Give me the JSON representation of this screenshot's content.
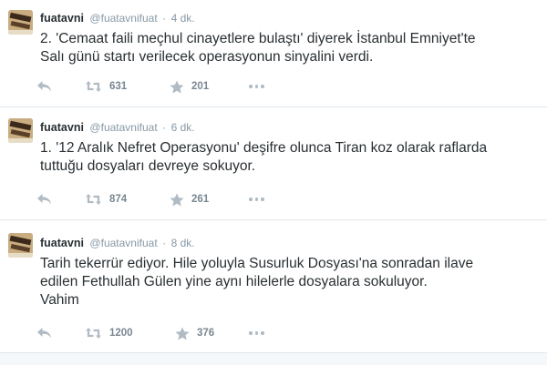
{
  "colors": {
    "text": "#292f33",
    "muted": "#8899a6",
    "action_icon": "#b1bbc3",
    "divider": "#e1e8ed",
    "background": "#ffffff"
  },
  "tweets": [
    {
      "fullname": "fuatavni",
      "username": "@fuatavnifuat",
      "separator": "·",
      "time": "4 dk.",
      "text": "2. 'Cemaat faili meçhul cinayetlere bulaştı' diyerek İstanbul Emniyet'te\nSalı günü startı verilecek operasyonun sinyalini verdi.",
      "retweets": "631",
      "favorites": "201",
      "icons": [
        "reply-icon",
        "retweet-icon",
        "favorite-icon",
        "more-icon"
      ]
    },
    {
      "fullname": "fuatavni",
      "username": "@fuatavnifuat",
      "separator": "·",
      "time": "6 dk.",
      "text": "1. '12 Aralık Nefret Operasyonu' deşifre olunca Tiran koz olarak raflarda\ntuttuğu dosyaları devreye sokuyor.",
      "retweets": "874",
      "favorites": "261",
      "icons": [
        "reply-icon",
        "retweet-icon",
        "favorite-icon",
        "more-icon"
      ]
    },
    {
      "fullname": "fuatavni",
      "username": "@fuatavnifuat",
      "separator": "·",
      "time": "8 dk.",
      "text": "Tarih tekerrür ediyor. Hile yoluyla Susurluk Dosyası'na sonradan ilave\nedilen Fethullah Gülen yine aynı hilelerle dosyalara sokuluyor.\nVahim",
      "retweets": "1200",
      "favorites": "376",
      "icons": [
        "reply-icon",
        "retweet-icon",
        "favorite-icon",
        "more-icon"
      ]
    }
  ]
}
